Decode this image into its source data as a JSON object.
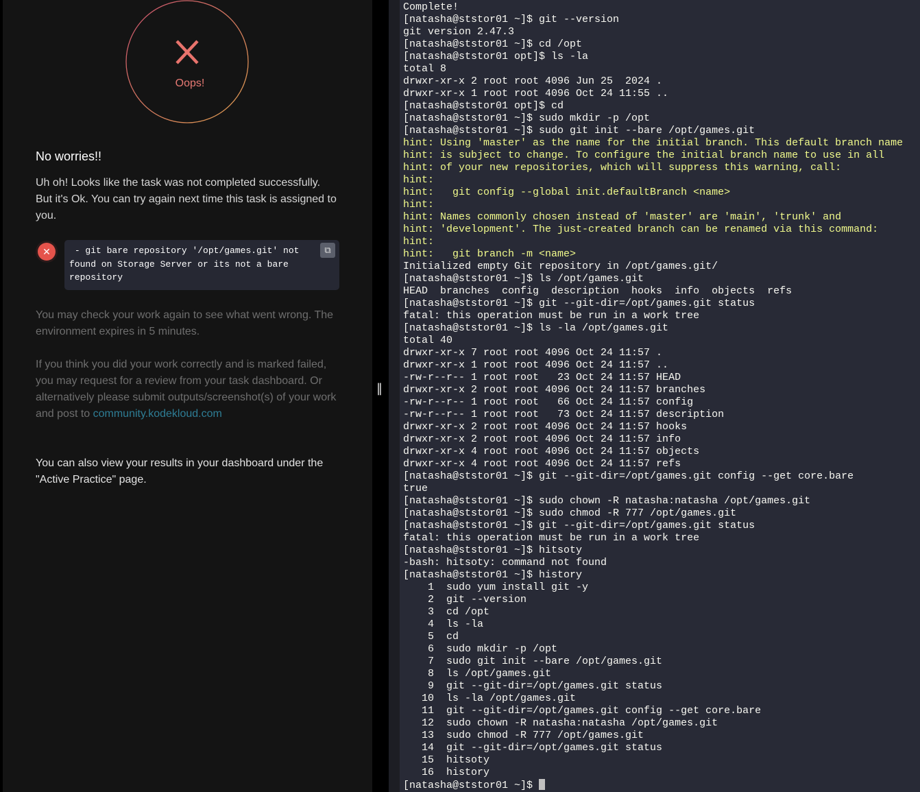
{
  "result": {
    "icon": "x-icon",
    "status_label": "Oops!",
    "heading": "No worries!!",
    "message": "Uh oh! Looks like the task was not completed successfully. But it's Ok. You can try again next time this task is assigned to you.",
    "error": " - git bare repository '/opt/games.git' not found on Storage Server or its not a bare repository",
    "recheck": "You may check your work again to see what went wrong. The environment expires in 5 minutes.",
    "review_text": "If you think you did your work correctly and is marked failed, you may request for a review from your task dashboard. Or alternatively please submit outputs/screenshot(s) of your work and post to ",
    "review_link": "community.kodekloud.com",
    "dashboard_note": "You can also view your results in your dashboard under the \"Active Practice\" page.",
    "colors": {
      "error": "#e5534b",
      "link": "#2e7d95",
      "hint": "#f1fa8c"
    }
  },
  "terminal": {
    "prompt_final": "[natasha@ststor01 ~]$ ",
    "lines": [
      {
        "t": "Complete!"
      },
      {
        "t": "[natasha@ststor01 ~]$ git --version"
      },
      {
        "t": "git version 2.47.3"
      },
      {
        "t": "[natasha@ststor01 ~]$ cd /opt"
      },
      {
        "t": "[natasha@ststor01 opt]$ ls -la"
      },
      {
        "t": "total 8"
      },
      {
        "t": "drwxr-xr-x 2 root root 4096 Jun 25  2024 ."
      },
      {
        "t": "drwxr-xr-x 1 root root 4096 Oct 24 11:55 .."
      },
      {
        "t": "[natasha@ststor01 opt]$ cd"
      },
      {
        "t": "[natasha@ststor01 ~]$ sudo mkdir -p /opt"
      },
      {
        "t": "[natasha@ststor01 ~]$ sudo git init --bare /opt/games.git"
      },
      {
        "t": "hint: Using 'master' as the name for the initial branch. This default branch name",
        "h": true
      },
      {
        "t": "hint: is subject to change. To configure the initial branch name to use in all",
        "h": true
      },
      {
        "t": "hint: of your new repositories, which will suppress this warning, call:",
        "h": true
      },
      {
        "t": "hint:",
        "h": true
      },
      {
        "t": "hint:   git config --global init.defaultBranch <name>",
        "h": true
      },
      {
        "t": "hint:",
        "h": true
      },
      {
        "t": "hint: Names commonly chosen instead of 'master' are 'main', 'trunk' and",
        "h": true
      },
      {
        "t": "hint: 'development'. The just-created branch can be renamed via this command:",
        "h": true
      },
      {
        "t": "hint:",
        "h": true
      },
      {
        "t": "hint:   git branch -m <name>",
        "h": true
      },
      {
        "t": "Initialized empty Git repository in /opt/games.git/"
      },
      {
        "t": "[natasha@ststor01 ~]$ ls /opt/games.git"
      },
      {
        "t": "HEAD  branches  config  description  hooks  info  objects  refs"
      },
      {
        "t": "[natasha@ststor01 ~]$ git --git-dir=/opt/games.git status"
      },
      {
        "t": "fatal: this operation must be run in a work tree"
      },
      {
        "t": "[natasha@ststor01 ~]$ ls -la /opt/games.git"
      },
      {
        "t": "total 40"
      },
      {
        "t": "drwxr-xr-x 7 root root 4096 Oct 24 11:57 ."
      },
      {
        "t": "drwxr-xr-x 1 root root 4096 Oct 24 11:57 .."
      },
      {
        "t": "-rw-r--r-- 1 root root   23 Oct 24 11:57 HEAD"
      },
      {
        "t": "drwxr-xr-x 2 root root 4096 Oct 24 11:57 branches"
      },
      {
        "t": "-rw-r--r-- 1 root root   66 Oct 24 11:57 config"
      },
      {
        "t": "-rw-r--r-- 1 root root   73 Oct 24 11:57 description"
      },
      {
        "t": "drwxr-xr-x 2 root root 4096 Oct 24 11:57 hooks"
      },
      {
        "t": "drwxr-xr-x 2 root root 4096 Oct 24 11:57 info"
      },
      {
        "t": "drwxr-xr-x 4 root root 4096 Oct 24 11:57 objects"
      },
      {
        "t": "drwxr-xr-x 4 root root 4096 Oct 24 11:57 refs"
      },
      {
        "t": "[natasha@ststor01 ~]$ git --git-dir=/opt/games.git config --get core.bare"
      },
      {
        "t": "true"
      },
      {
        "t": "[natasha@ststor01 ~]$ sudo chown -R natasha:natasha /opt/games.git"
      },
      {
        "t": "[natasha@ststor01 ~]$ sudo chmod -R 777 /opt/games.git"
      },
      {
        "t": "[natasha@ststor01 ~]$ git --git-dir=/opt/games.git status"
      },
      {
        "t": "fatal: this operation must be run in a work tree"
      },
      {
        "t": "[natasha@ststor01 ~]$ hitsoty"
      },
      {
        "t": "-bash: hitsoty: command not found"
      },
      {
        "t": "[natasha@ststor01 ~]$ history"
      },
      {
        "t": "    1  sudo yum install git -y"
      },
      {
        "t": "    2  git --version"
      },
      {
        "t": "    3  cd /opt"
      },
      {
        "t": "    4  ls -la"
      },
      {
        "t": "    5  cd"
      },
      {
        "t": "    6  sudo mkdir -p /opt"
      },
      {
        "t": "    7  sudo git init --bare /opt/games.git"
      },
      {
        "t": "    8  ls /opt/games.git"
      },
      {
        "t": "    9  git --git-dir=/opt/games.git status"
      },
      {
        "t": "   10  ls -la /opt/games.git"
      },
      {
        "t": "   11  git --git-dir=/opt/games.git config --get core.bare"
      },
      {
        "t": "   12  sudo chown -R natasha:natasha /opt/games.git"
      },
      {
        "t": "   13  sudo chmod -R 777 /opt/games.git"
      },
      {
        "t": "   14  git --git-dir=/opt/games.git status"
      },
      {
        "t": "   15  hitsoty"
      },
      {
        "t": "   16  history"
      }
    ]
  }
}
